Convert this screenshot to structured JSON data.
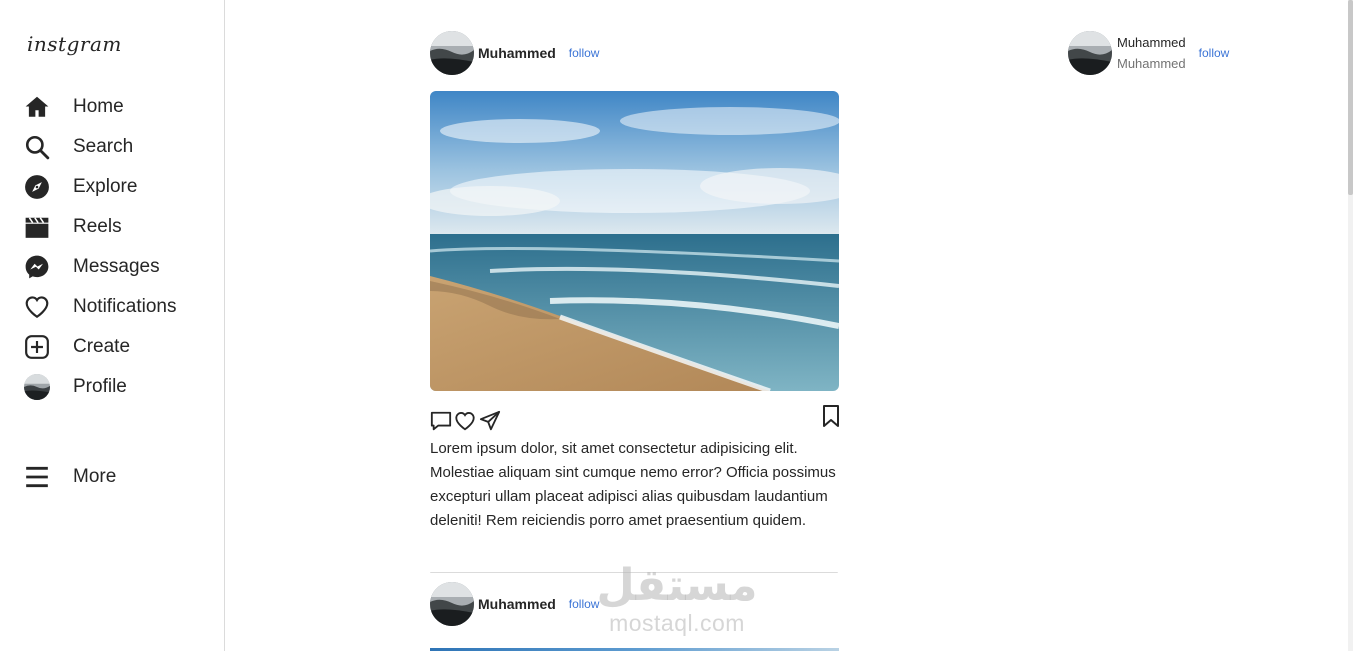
{
  "app": {
    "logo": "instgram"
  },
  "sidebar": {
    "items": [
      {
        "label": "Home",
        "icon": "home-icon"
      },
      {
        "label": "Search",
        "icon": "search-icon"
      },
      {
        "label": "Explore",
        "icon": "compass-icon"
      },
      {
        "label": "Reels",
        "icon": "clapperboard-icon"
      },
      {
        "label": "Messages",
        "icon": "messenger-icon"
      },
      {
        "label": "Notifications",
        "icon": "heart-icon"
      },
      {
        "label": "Create",
        "icon": "plus-square-icon"
      },
      {
        "label": "Profile",
        "icon": "profile-avatar"
      }
    ],
    "more": {
      "label": "More",
      "icon": "hamburger-icon"
    }
  },
  "feed": {
    "posts": [
      {
        "username": "Muhammed",
        "follow_label": "follow",
        "image": "beach-photo",
        "caption": "Lorem ipsum dolor, sit amet consectetur adipisicing elit. Molestiae aliquam sint cumque nemo error? Officia possimus excepturi ullam placeat adipisci alias quibusdam laudantium deleniti! Rem reiciendis porro amet praesentium quidem."
      },
      {
        "username": "Muhammed",
        "follow_label": "follow",
        "image": "beach-photo"
      }
    ]
  },
  "suggestion": {
    "name": "Muhammed",
    "subname": "Muhammed",
    "follow_label": "follow"
  },
  "watermark": {
    "arabic": "مستقل",
    "latin": "mostaql.com"
  },
  "colors": {
    "link": "#3b74d6",
    "text": "#262626",
    "border": "#dbdbdb"
  }
}
